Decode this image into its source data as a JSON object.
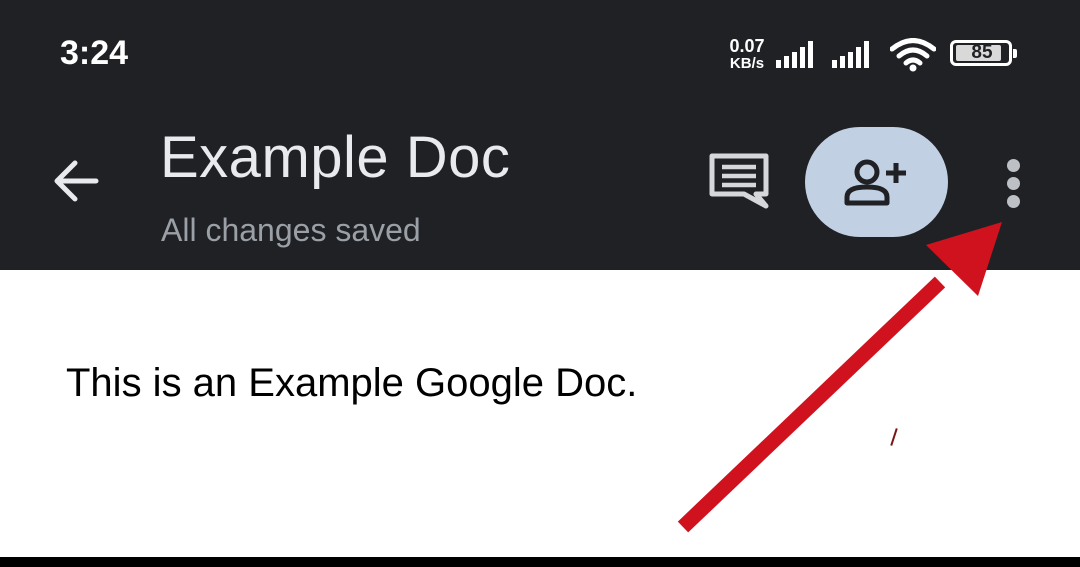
{
  "status_bar": {
    "time": "3:24",
    "net_speed_value": "0.07",
    "net_speed_unit": "KB/s",
    "battery_level": "85",
    "icons": [
      "signal-icon",
      "signal-icon",
      "wifi-icon",
      "battery-icon"
    ]
  },
  "app_bar": {
    "back_icon": "arrow-left-icon",
    "title": "Example Doc",
    "status": "All changes saved",
    "comments_icon": "comment-icon",
    "share_icon": "person-add-icon",
    "more_icon": "more-vertical-icon"
  },
  "document": {
    "body_text": "This is an Example Google Doc."
  },
  "colors": {
    "app_bar_bg": "#1f2125",
    "share_button_bg": "#c2d0e3",
    "annotation_arrow": "#d0121e"
  }
}
